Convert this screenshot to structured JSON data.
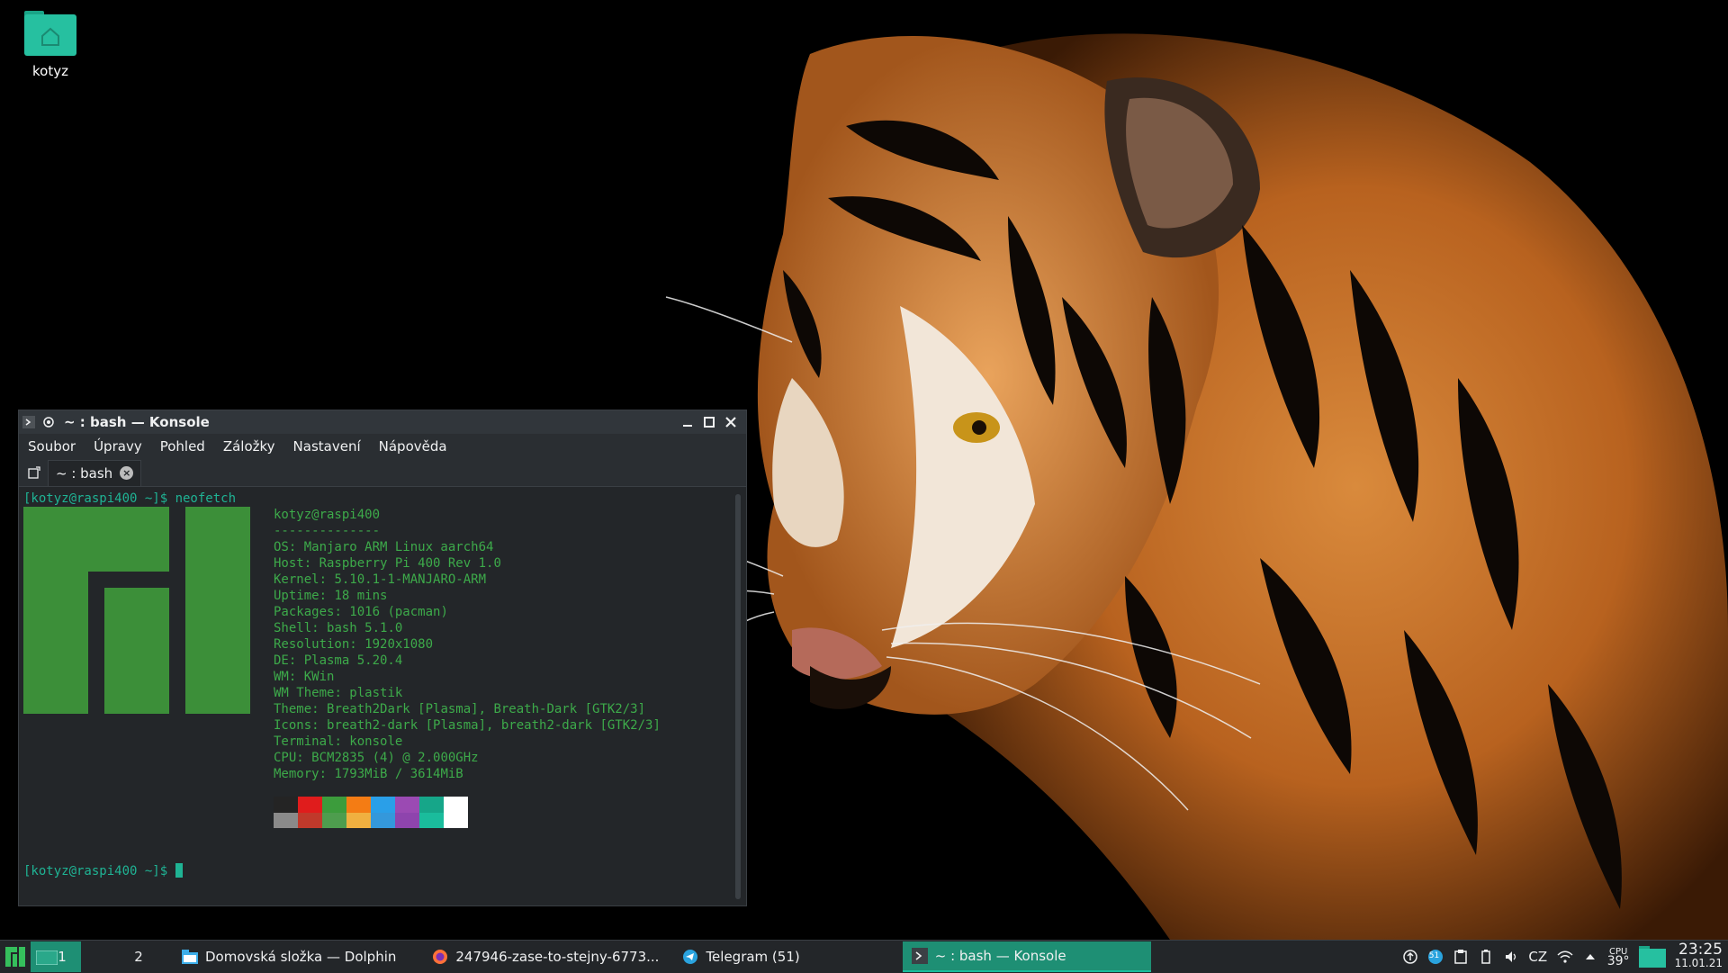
{
  "desktop": {
    "home_icon_label": "kotyz"
  },
  "konsole": {
    "title": "~ : bash — Konsole",
    "menu": [
      "Soubor",
      "Úpravy",
      "Pohled",
      "Záložky",
      "Nastavení",
      "Nápověda"
    ],
    "tab_label": "~ : bash",
    "prompt": "[kotyz@raspi400 ~]$ ",
    "command": "neofetch",
    "neofetch": {
      "header": "kotyz@raspi400",
      "separator": "--------------",
      "lines": [
        {
          "key": "OS",
          "value": "Manjaro ARM Linux aarch64"
        },
        {
          "key": "Host",
          "value": "Raspberry Pi 400 Rev 1.0"
        },
        {
          "key": "Kernel",
          "value": "5.10.1-1-MANJARO-ARM"
        },
        {
          "key": "Uptime",
          "value": "18 mins"
        },
        {
          "key": "Packages",
          "value": "1016 (pacman)"
        },
        {
          "key": "Shell",
          "value": "bash 5.1.0"
        },
        {
          "key": "Resolution",
          "value": "1920x1080"
        },
        {
          "key": "DE",
          "value": "Plasma 5.20.4"
        },
        {
          "key": "WM",
          "value": "KWin"
        },
        {
          "key": "WM Theme",
          "value": "plastik"
        },
        {
          "key": "Theme",
          "value": "Breath2Dark [Plasma], Breath-Dark [GTK2/3]"
        },
        {
          "key": "Icons",
          "value": "breath2-dark [Plasma], breath2-dark [GTK2/3]"
        },
        {
          "key": "Terminal",
          "value": "konsole"
        },
        {
          "key": "CPU",
          "value": "BCM2835 (4) @ 2.000GHz"
        },
        {
          "key": "Memory",
          "value": "1793MiB / 3614MiB"
        }
      ],
      "colors": [
        "#242424",
        "#e01c1c",
        "#3c9c3c",
        "#f47c14",
        "#2a9fe8",
        "#9b4ab3",
        "#16a689",
        "#ffffff"
      ],
      "colors_dim": [
        "#8a8a8a",
        "#c0392b",
        "#4e9d4e",
        "#f0b040",
        "#3498db",
        "#8e44ad",
        "#1abc9c",
        "#ffffff"
      ]
    },
    "final_prompt": "[kotyz@raspi400 ~]$ "
  },
  "taskbar": {
    "desktop_1": "1",
    "desktop_2": "2",
    "tasks": [
      {
        "label": "Domovská složka — Dolphin",
        "icon": "folder-icon"
      },
      {
        "label": "247946-zase-to-stejny-6773...",
        "icon": "firefox-icon"
      },
      {
        "label": "Telegram (51)",
        "icon": "telegram-icon"
      },
      {
        "label": "~ : bash — Konsole",
        "icon": "terminal-icon",
        "active": true
      }
    ],
    "tray": {
      "telegram_badge": "51",
      "keyboard_layout": "CZ",
      "cpu_label": "CPU",
      "cpu_temp": "39°",
      "time": "23:25",
      "date": "11.01.21"
    }
  },
  "colors": {
    "accent": "#1e8f74",
    "terminal_text": "#1fb394",
    "neofetch_info": "#3daa4a",
    "manjaro_logo": "#3c8f39"
  }
}
